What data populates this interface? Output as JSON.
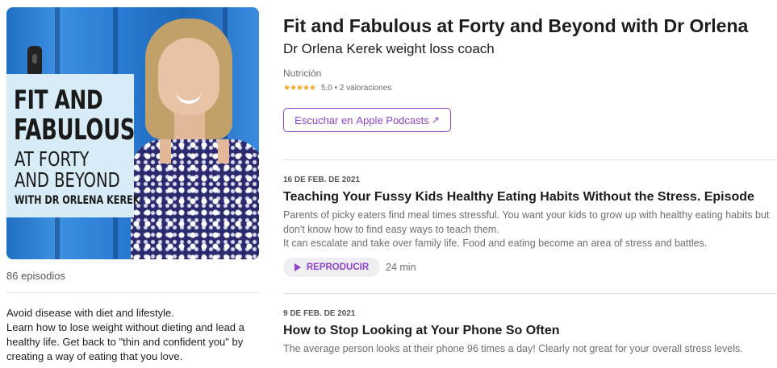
{
  "podcast": {
    "title": "Fit and Fabulous at Forty and Beyond with Dr Orlena",
    "author": "Dr Orlena Kerek weight loss coach",
    "category": "Nutrición",
    "rating_stars": "★★★★★",
    "rating_text": "5,0 • 2 valoraciones",
    "rating_value": 5.0,
    "listen_button": {
      "prefix": "Escuchar en",
      "strong": "Apple Podcasts",
      "icon": "external-arrow-icon",
      "glyph": "↗"
    },
    "accent_color": "#8e44c9"
  },
  "artwork": {
    "line1": "FIT AND",
    "line2": "FABULOUS",
    "line3": "AT FORTY",
    "line4": "AND BEYOND",
    "line5": "WITH DR ORLENA KEREK"
  },
  "sidebar": {
    "episode_count": "86 episodios",
    "description_lines": [
      "Avoid disease with diet and lifestyle.",
      "Learn how to lose weight without dieting and lead a healthy life. Get back to \"thin and confident you\" by creating a way of eating that you love."
    ]
  },
  "episodes": [
    {
      "date": "16 DE FEB. DE 2021",
      "title": "Teaching Your Fussy Kids Healthy Eating Habits Without the Stress. Episode",
      "desc_lines": [
        "Parents of picky eaters find meal times stressful. You want your kids to grow up with healthy eating habits but don't know how to find easy ways to teach them.",
        "It can escalate and take over family life. Food and eating become an area of stress and battles."
      ],
      "play_label": "REPRODUCIR",
      "duration": "24 min"
    },
    {
      "date": "9 DE FEB. DE 2021",
      "title": "How to Stop Looking at Your Phone So Often",
      "desc_lines": [
        "The average person looks at their phone 96 times a day! Clearly not great for your overall stress levels."
      ]
    }
  ]
}
